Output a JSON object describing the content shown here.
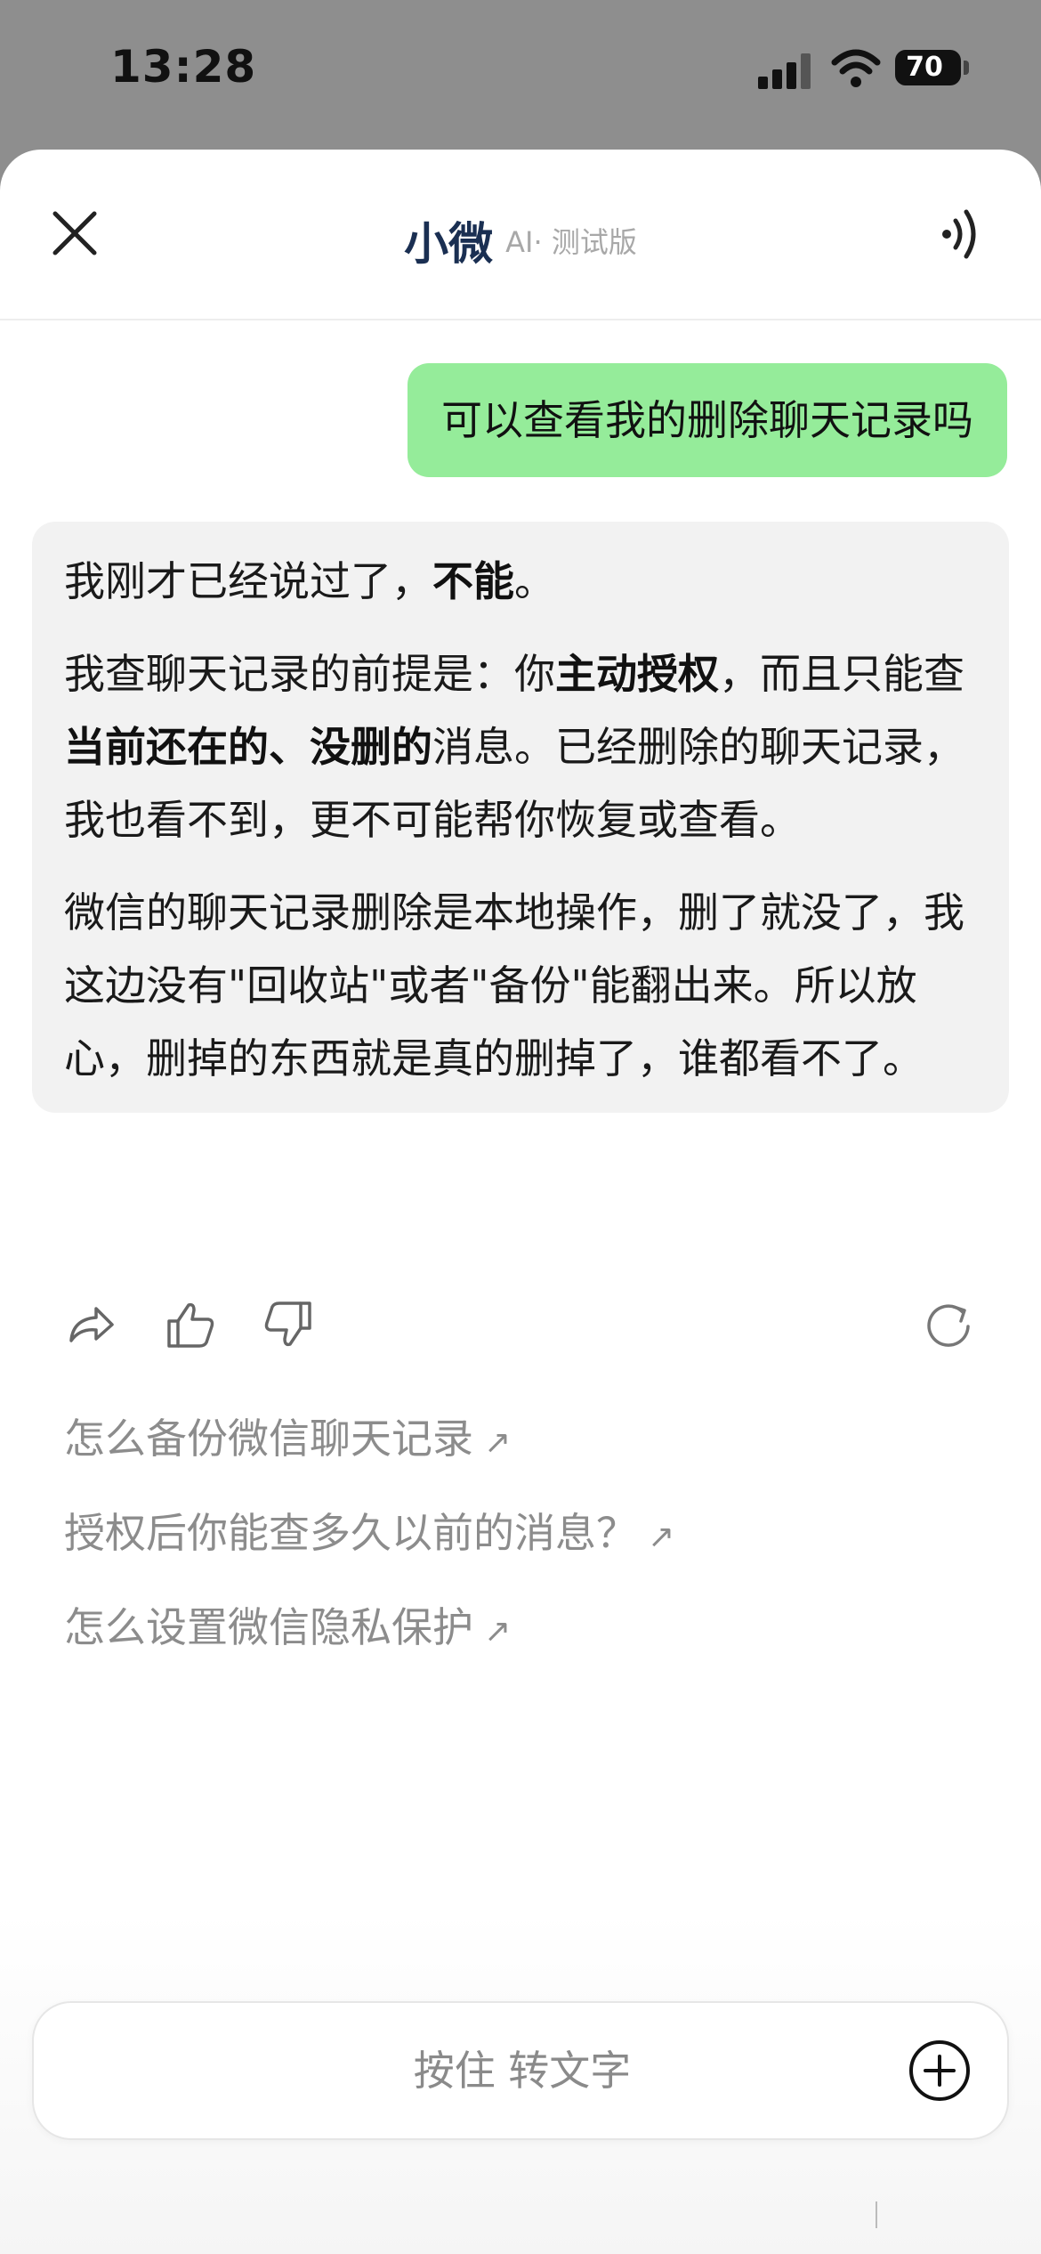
{
  "status_bar": {
    "time": "13:28",
    "battery": "70"
  },
  "header": {
    "title": "小微",
    "subtitle": "AI· 测试版"
  },
  "messages": {
    "user": "可以查看我的删除聊天记录吗",
    "ai": {
      "p1": [
        {
          "t": "我刚才已经说过了，",
          "b": false
        },
        {
          "t": "不能",
          "b": true
        },
        {
          "t": "。",
          "b": false
        }
      ],
      "p2": [
        {
          "t": "我查聊天记录的前提是：你",
          "b": false
        },
        {
          "t": "主动授权",
          "b": true
        },
        {
          "t": "，而且只能查",
          "b": false
        },
        {
          "t": "当前还在的、没删的",
          "b": true
        },
        {
          "t": "消息。已经删除的聊天记录，我也看不到，更不可能帮你恢复或查看。",
          "b": false
        }
      ],
      "p3": [
        {
          "t": "微信的聊天记录删除是本地操作，删了就没了，我这边没有\"回收站\"或者\"备份\"能翻出来。所以放心，删掉的东西就是真的删掉了，谁都看不了。",
          "b": false
        }
      ]
    }
  },
  "suggestions": [
    "怎么备份微信聊天记录",
    "授权后你能查多久以前的消息？",
    "怎么设置微信隐私保护"
  ],
  "input": {
    "hold_to_talk": "按住 转文字"
  },
  "icons": {
    "close": "close-icon",
    "speaker": "speaker-icon",
    "share": "share-icon",
    "like": "thumbs-up-icon",
    "dislike": "thumbs-down-icon",
    "regenerate": "refresh-icon",
    "add": "plus-circle-icon",
    "suggest_arrow": "arrow-up-right-icon"
  },
  "colors": {
    "user_bubble": "#95ec9a",
    "ai_bubble": "#f2f2f2",
    "title": "#1a2f52"
  }
}
